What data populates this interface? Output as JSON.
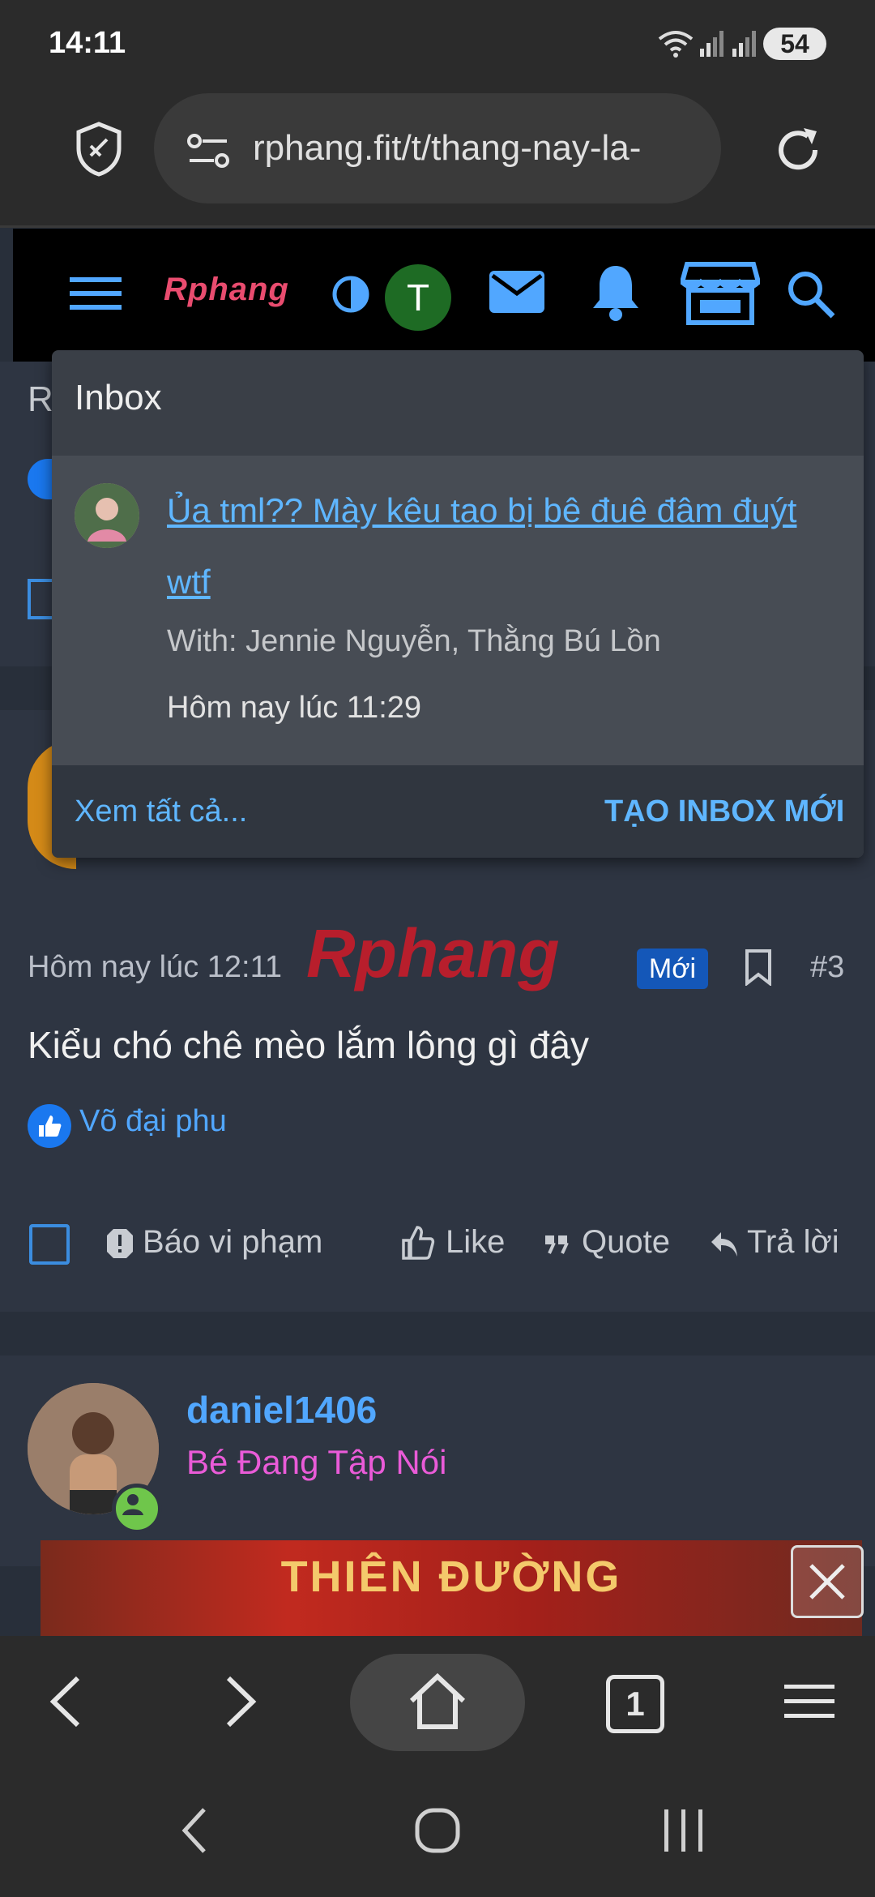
{
  "status_bar": {
    "time": "14:11",
    "battery": "54"
  },
  "browser": {
    "url": "rphang.fit/t/thang-nay-la-",
    "tab_count": "1"
  },
  "site": {
    "logo_text": "Rphang",
    "avatar_letter": "T"
  },
  "background": {
    "partial_letter": "R",
    "post": {
      "meta_time": "Hôm nay lúc 12:11",
      "new_badge": "Mới",
      "post_number": "#3",
      "content": "Kiểu chó chê mèo lắm lông gì đây",
      "reactor": "Võ đại phu",
      "actions": {
        "report": "Báo vi phạm",
        "like": "Like",
        "quote": "Quote",
        "reply": "Trả lời"
      }
    },
    "next_user": {
      "name": "daniel1406",
      "title": "Bé Đang Tập Nói"
    },
    "watermark": "Rphang",
    "banner_text": "THIÊN ĐƯỜNG"
  },
  "inbox_dropdown": {
    "title": "Inbox",
    "entry": {
      "subject": "Ủa tml?? Mày kêu tao bị bê đuê đâm đuýt wtf",
      "with": "With: Jennie Nguyễn, Thằng Bú Lồn",
      "time": "Hôm nay lúc 11:29"
    },
    "view_all": "Xem tất cả...",
    "new_inbox": "TẠO INBOX MỚI"
  },
  "colors": {
    "accent": "#51a7ff",
    "link": "#5fb6ff",
    "badge": "#1457b8",
    "title_pink": "#ea5bd8"
  }
}
